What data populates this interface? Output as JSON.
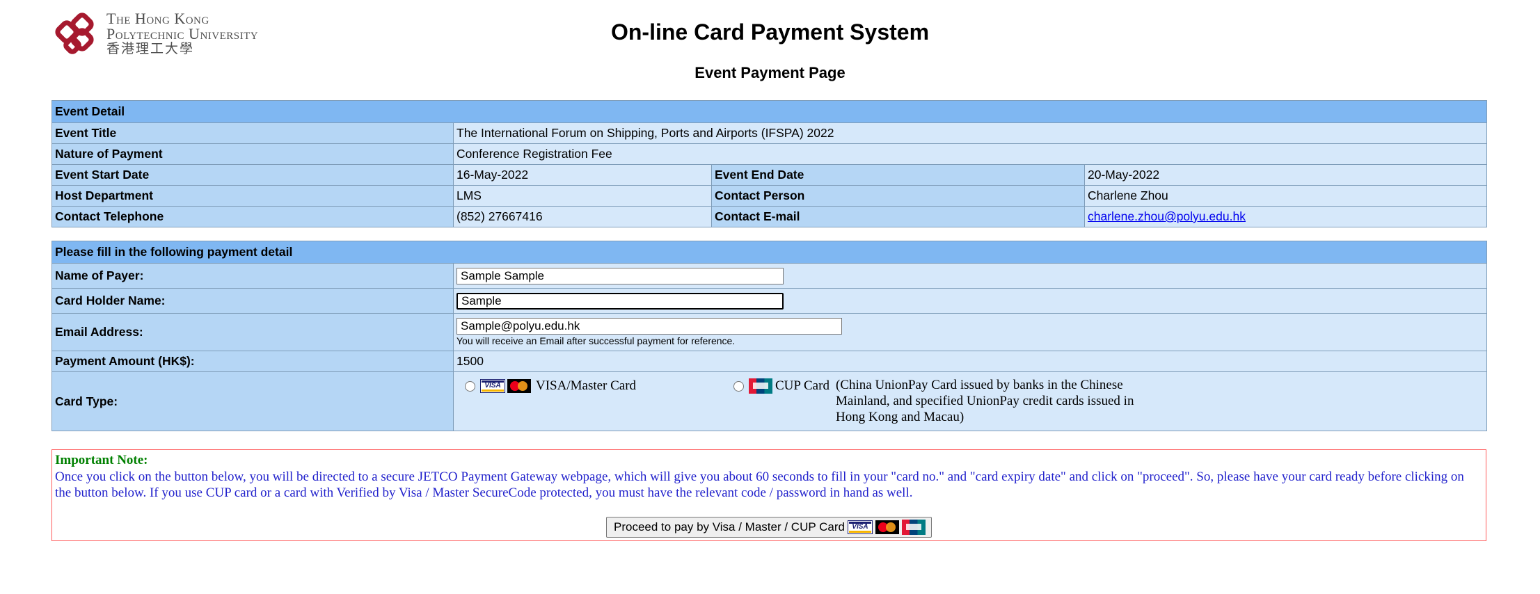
{
  "header": {
    "logo_line1": "The Hong Kong",
    "logo_line2": "Polytechnic University",
    "logo_line3": "香港理工大學",
    "title": "On-line Card Payment System",
    "subtitle": "Event Payment Page"
  },
  "event": {
    "section_title": "Event Detail",
    "title_label": "Event Title",
    "title_value": "The International Forum on Shipping, Ports and Airports (IFSPA) 2022",
    "nature_label": "Nature of Payment",
    "nature_value": "Conference Registration Fee",
    "start_label": "Event Start Date",
    "start_value": "16-May-2022",
    "end_label": "Event End Date",
    "end_value": "20-May-2022",
    "host_label": "Host Department",
    "host_value": "LMS",
    "contact_label": "Contact Person",
    "contact_value": "Charlene Zhou",
    "tel_label": "Contact Telephone",
    "tel_value": "(852) 27667416",
    "email_label": "Contact E-mail",
    "email_value": "charlene.zhou@polyu.edu.hk"
  },
  "payment": {
    "section_title": "Please fill in the following payment detail",
    "payer_label": "Name of Payer:",
    "payer_value": "Sample Sample",
    "holder_label": "Card Holder Name:",
    "holder_value": "Sample",
    "email_label": "Email Address:",
    "email_value": "Sample@polyu.edu.hk",
    "email_hint": "You will receive an Email after successful payment for reference.",
    "amount_label": "Payment Amount (HK$):",
    "amount_value": "1500",
    "card_label": "Card Type:",
    "visa_option": "VISA/Master Card",
    "cup_option": "CUP Card",
    "cup_description": "(China UnionPay Card issued by banks in the Chinese Mainland, and specified UnionPay credit cards issued in Hong Kong and Macau)"
  },
  "note": {
    "title": "Important Note:",
    "body": "Once you click on the button below, you will be directed to a secure JETCO Payment Gateway webpage, which will give you about 60 seconds to fill in your \"card no.\" and \"card expiry date\" and click on \"proceed\". So, please have your card ready before clicking on the button below. If you use CUP card or a card with Verified by Visa / Master SecureCode protected, you must have the relevant code / password in hand as well.",
    "button_label": "Proceed to pay by Visa / Master / CUP Card"
  },
  "icons": {
    "logo": "polyu-logo-icon",
    "visa": "visa-card-icon",
    "mastercard": "mastercard-icon",
    "cup": "unionpay-card-icon"
  },
  "colors": {
    "section_header_bg": "#7fb7f2",
    "label_bg": "#b5d6f5",
    "value_bg": "#d6e8fa",
    "logo_red": "#a6192e",
    "note_border": "#ff5a5a",
    "note_title": "#008000",
    "note_text": "#2222cc"
  }
}
